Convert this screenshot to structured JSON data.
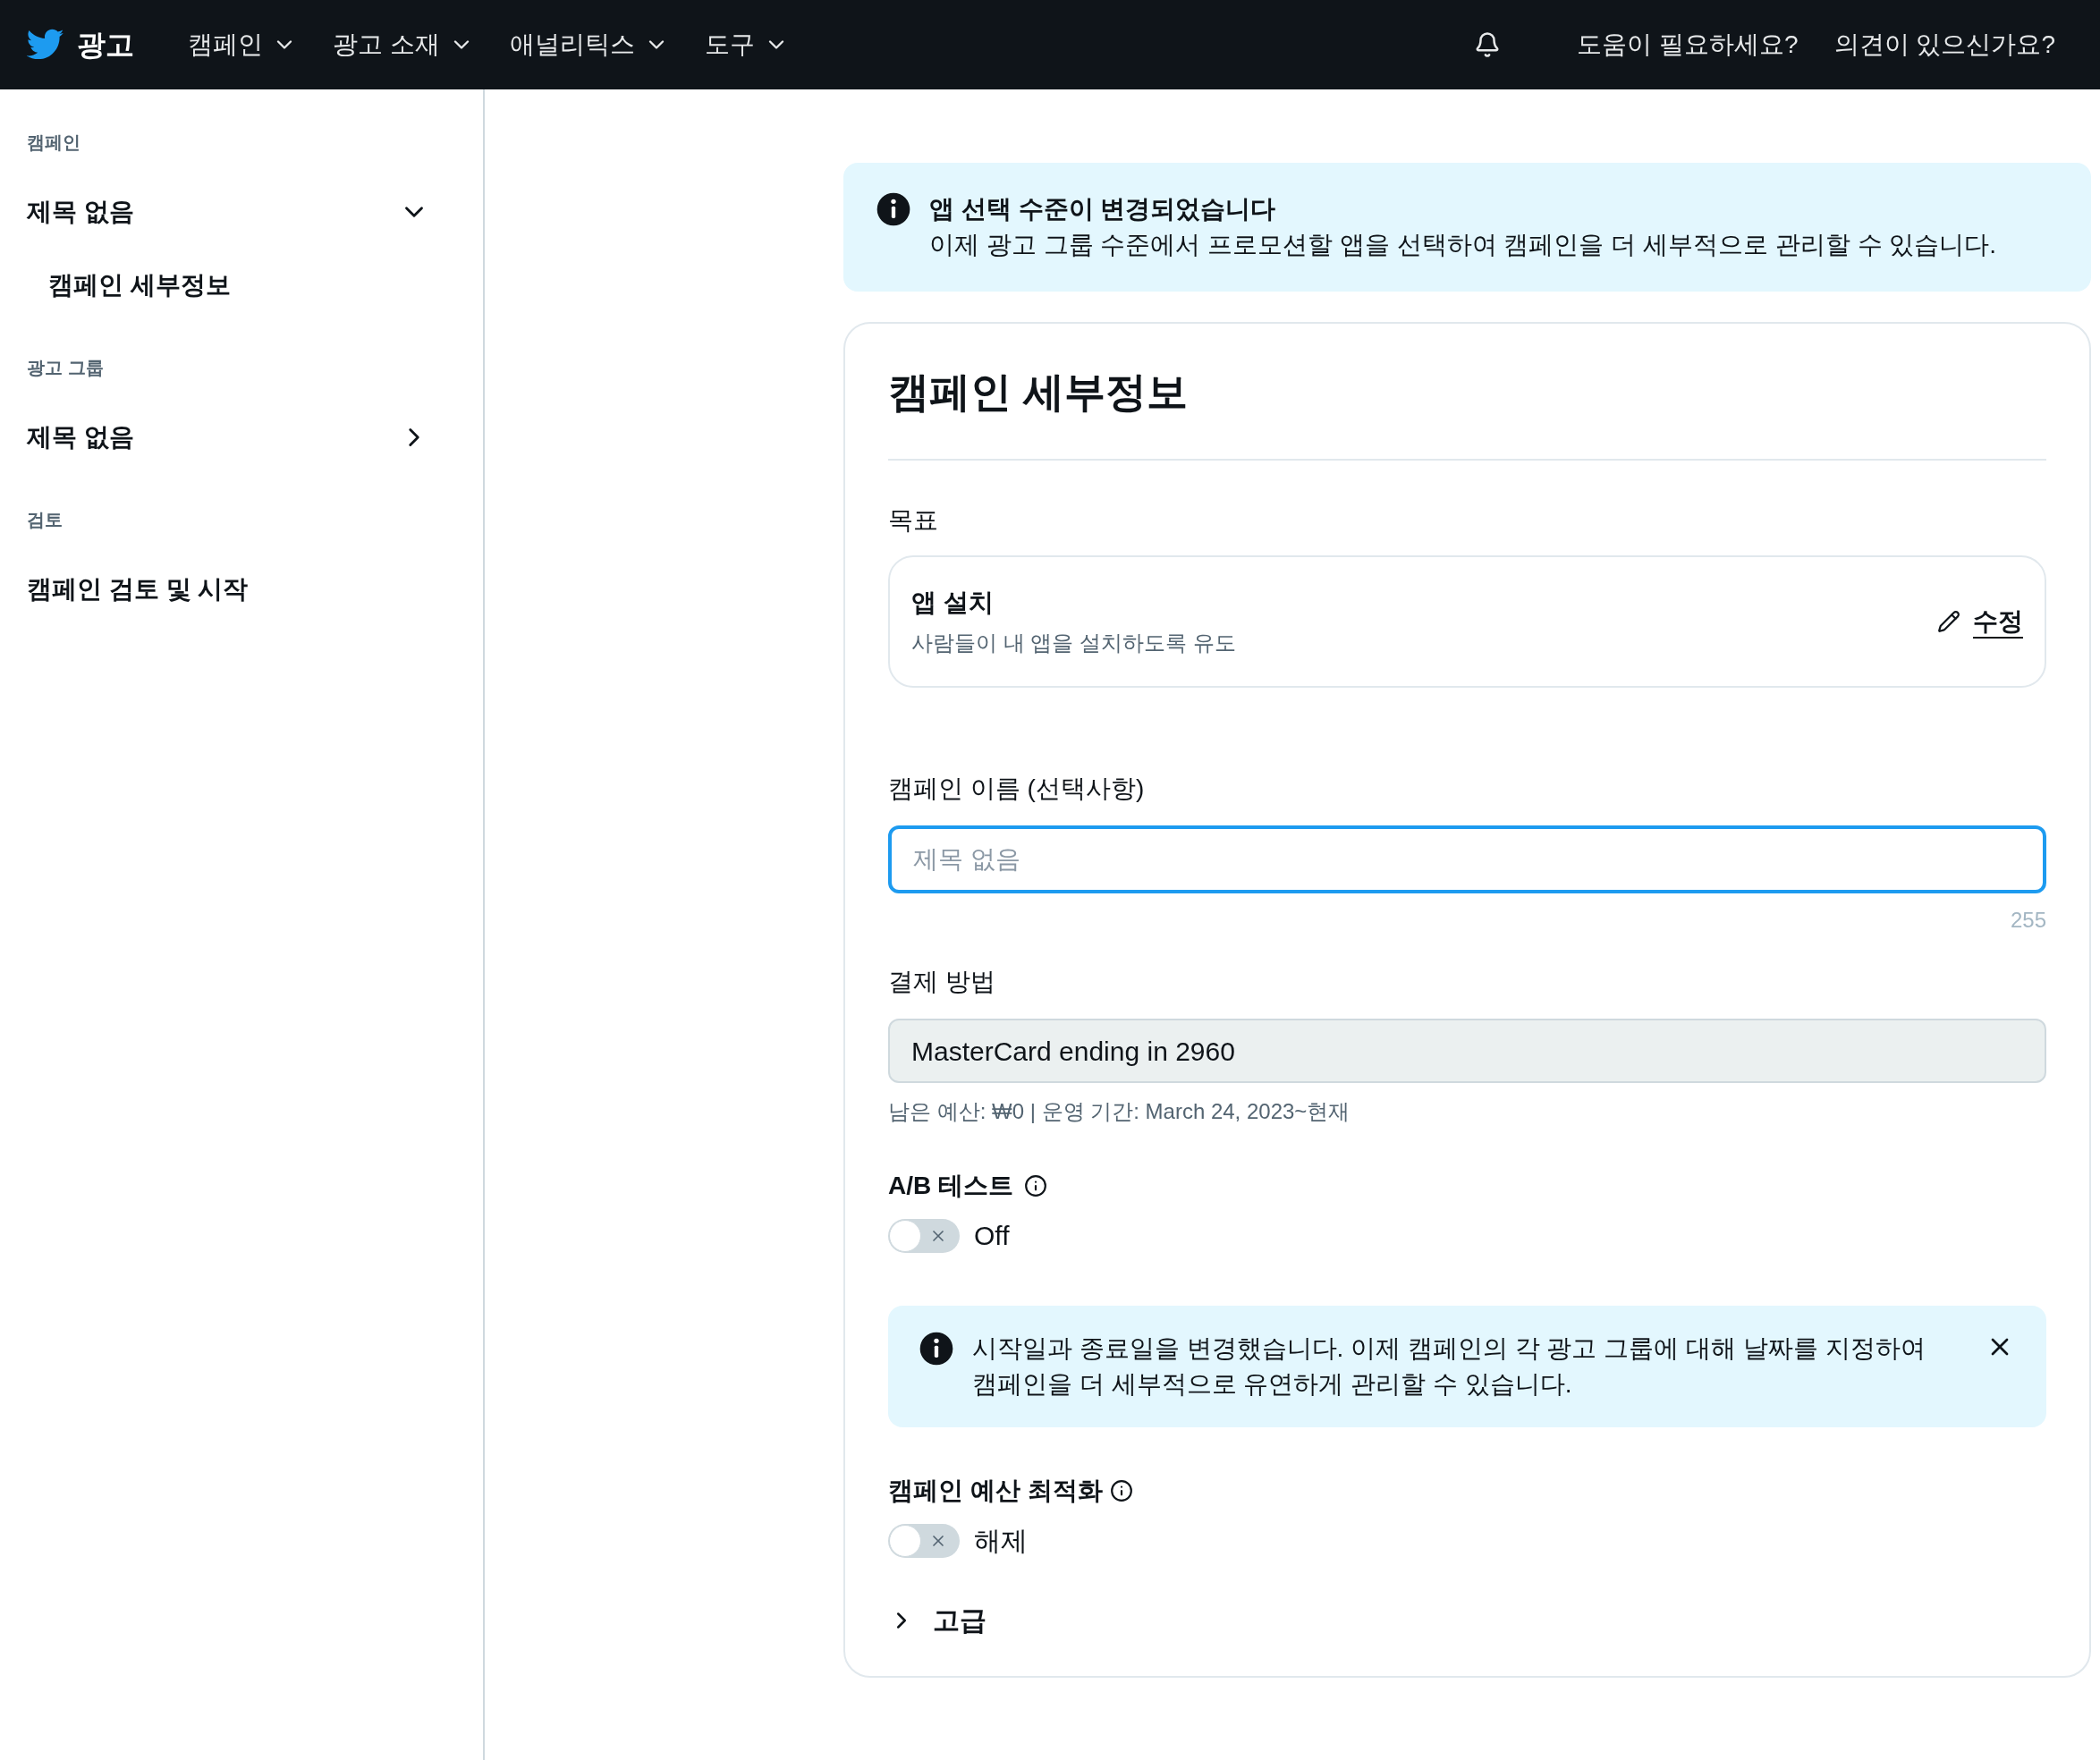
{
  "topbar": {
    "brand": "광고",
    "menus": [
      {
        "label": "캠페인"
      },
      {
        "label": "광고 소재"
      },
      {
        "label": "애널리틱스"
      },
      {
        "label": "도구"
      }
    ],
    "links": [
      "도움이 필요하세요?",
      "의견이 있으신가요?"
    ]
  },
  "sidebar": {
    "sections": [
      {
        "heading": "캠페인",
        "items": [
          {
            "label": "제목 없음",
            "expanded": true,
            "children": [
              {
                "label": "캠페인 세부정보"
              }
            ]
          }
        ]
      },
      {
        "heading": "광고 그룹",
        "items": [
          {
            "label": "제목 없음",
            "expanded": false
          }
        ]
      },
      {
        "heading": "검토",
        "items": [
          {
            "label": "캠페인 검토 및 시작"
          }
        ]
      }
    ]
  },
  "banner": {
    "title": "앱 선택 수준이 변경되었습니다",
    "text": "이제 광고 그룹 수준에서 프로모션할 앱을 선택하여 캠페인을 더 세부적으로 관리할 수 있습니다."
  },
  "card": {
    "title": "캠페인 세부정보",
    "objective": {
      "label": "목표",
      "name": "앱 설치",
      "description": "사람들이 내 앱을 설치하도록 유도",
      "edit_label": "수정"
    },
    "campaign_name": {
      "label": "캠페인 이름 (선택사항)",
      "placeholder": "제목 없음",
      "counter": "255",
      "focused": true
    },
    "payment": {
      "label": "결제 방법",
      "value": "MasterCard ending in 2960",
      "note": "남은 예산: ₩0 | 운영 기간: March 24, 2023~현재"
    },
    "ab_test": {
      "label": "A/B 테스트",
      "on": false,
      "state_label": "Off"
    },
    "notice": {
      "text": "시작일과 종료일을 변경했습니다. 이제 캠페인의 각 광고 그룹에 대해 날짜를 지정하여 캠페인을 더 세부적으로 유연하게 관리할 수 있습니다."
    },
    "budget_optimization": {
      "label": "캠페인 예산 최적화",
      "on": false,
      "state_label": "해제"
    },
    "advanced": {
      "label": "고급",
      "expanded": false
    }
  }
}
